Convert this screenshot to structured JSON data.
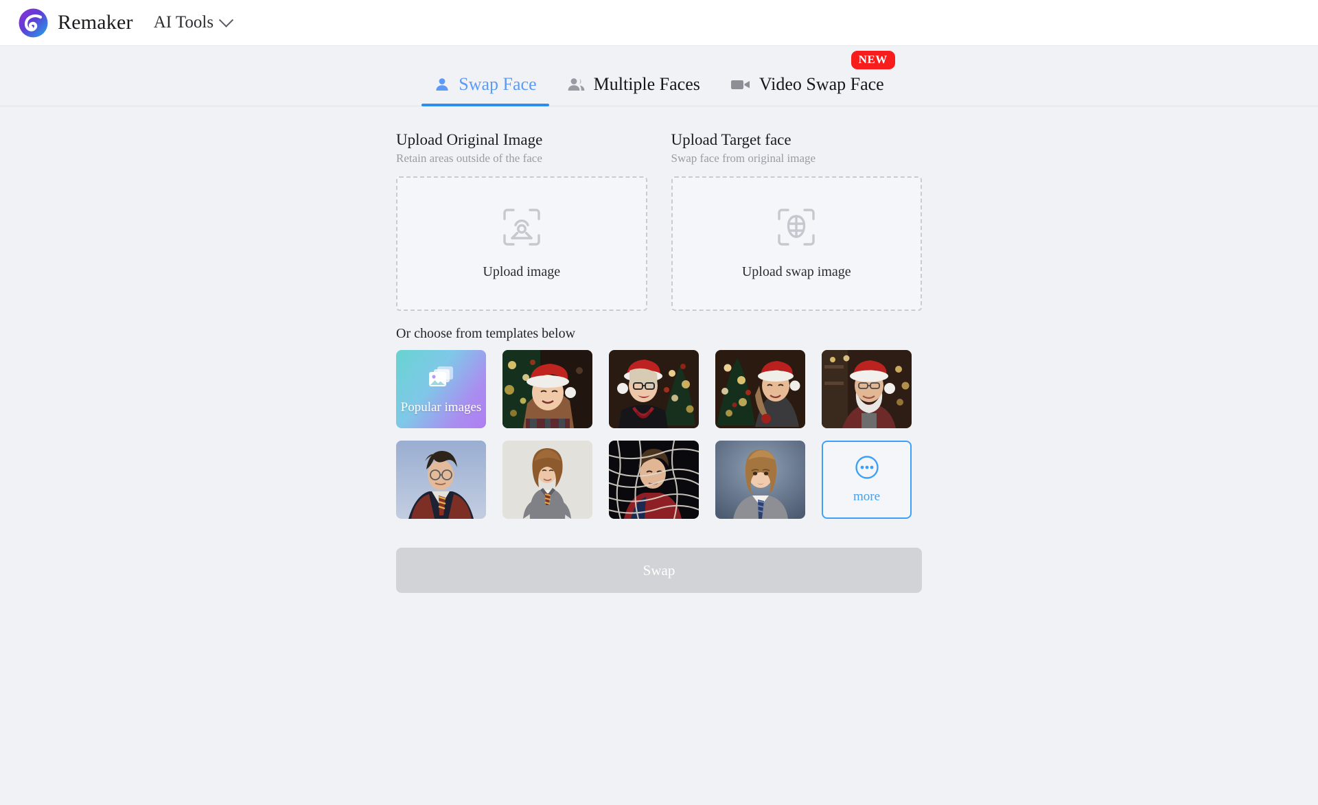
{
  "header": {
    "brand_name": "Remaker",
    "logo_icon": "remaker-swirl-logo",
    "menu_label": "AI Tools",
    "chevron_icon": "chevron-down-icon"
  },
  "tabs": [
    {
      "label": "Swap Face",
      "icon": "single-person-icon",
      "active": true,
      "badge": ""
    },
    {
      "label": "Multiple Faces",
      "icon": "multiple-people-icon",
      "active": false,
      "badge": ""
    },
    {
      "label": "Video Swap Face",
      "icon": "video-camera-icon",
      "active": false,
      "badge": "NEW"
    }
  ],
  "uploads": [
    {
      "title": "Upload Original Image",
      "subtitle": "Retain areas outside of the face",
      "dropzone_label": "Upload image",
      "icon": "face-scan-frame-icon"
    },
    {
      "title": "Upload Target face",
      "subtitle": "Swap face from original image",
      "dropzone_label": "Upload swap image",
      "icon": "face-oval-crosshair-frame-icon"
    }
  ],
  "templates": {
    "label": "Or choose from templates below",
    "popular": {
      "label": "Popular images",
      "icon": "stacked-photos-icon",
      "gradient_from": "#67d3d1",
      "gradient_to": "#b07df2"
    },
    "items": [
      {
        "name": "girl-in-santa-hat-christmas-lights"
      },
      {
        "name": "older-woman-glasses-santa-hat-red-beads"
      },
      {
        "name": "young-woman-santa-hat-christmas-tree"
      },
      {
        "name": "bearded-man-santa-hat-maroon-sweater"
      },
      {
        "name": "harry-potter-gryffindor-robes"
      },
      {
        "name": "hermione-granger-grey-sweater"
      },
      {
        "name": "spiderman-peter-parker-in-webs"
      },
      {
        "name": "schoolgirl-grey-blazer-blue-tie"
      }
    ],
    "more": {
      "label": "more",
      "icon": "ellipsis-circle-icon",
      "color": "#3da0f7"
    }
  },
  "swap_button": {
    "label": "Swap",
    "enabled": false,
    "color": "#d2d3d6"
  },
  "colors": {
    "page_bg": "#f1f2f6",
    "header_bg": "#ffffff",
    "accent_blue": "#2d8cf0",
    "badge_red": "#f81d1d"
  }
}
